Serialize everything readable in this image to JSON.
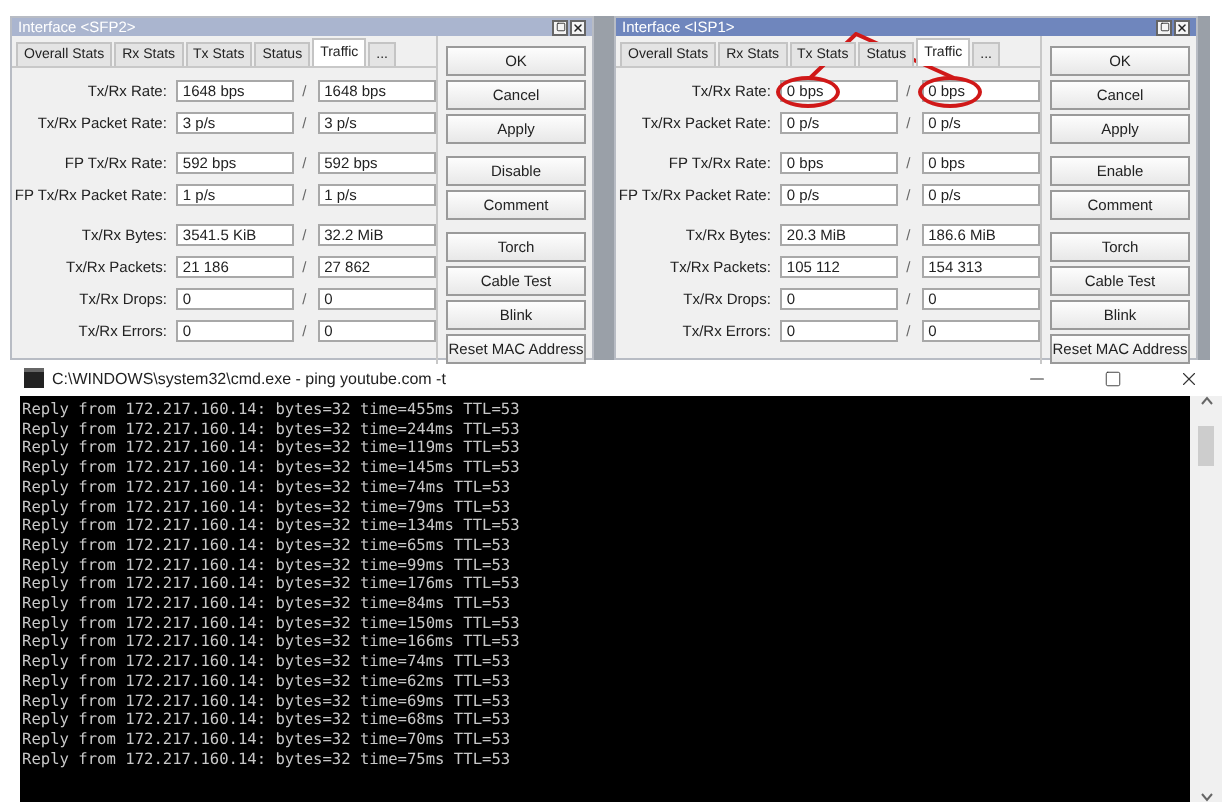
{
  "windows": [
    {
      "title": "Interface <SFP2>",
      "active": false,
      "tabs": [
        {
          "label": "Overall Stats",
          "selected": false
        },
        {
          "label": "Rx Stats",
          "selected": false
        },
        {
          "label": "Tx Stats",
          "selected": false
        },
        {
          "label": "Status",
          "selected": false
        },
        {
          "label": "Traffic",
          "selected": true
        },
        {
          "label": "...",
          "selected": false
        }
      ],
      "sections": [
        [
          {
            "label": "Tx/Rx Rate:",
            "tx": {
              "value": "1648 bps",
              "circled": false
            },
            "separator": "/",
            "rx": {
              "value": "1648 bps",
              "circled": false
            }
          },
          {
            "label": "Tx/Rx Packet Rate:",
            "tx": {
              "value": "3 p/s",
              "circled": false
            },
            "separator": "/",
            "rx": {
              "value": "3 p/s",
              "circled": false
            }
          }
        ],
        [
          {
            "label": "FP Tx/Rx Rate:",
            "tx": {
              "value": "592 bps",
              "circled": false
            },
            "separator": "/",
            "rx": {
              "value": "592 bps",
              "circled": false
            }
          },
          {
            "label": "FP Tx/Rx Packet Rate:",
            "tx": {
              "value": "1 p/s",
              "circled": false
            },
            "separator": "/",
            "rx": {
              "value": "1 p/s",
              "circled": false
            }
          }
        ],
        [
          {
            "label": "Tx/Rx Bytes:",
            "tx": {
              "value": "3541.5 KiB",
              "circled": false
            },
            "separator": "/",
            "rx": {
              "value": "32.2 MiB",
              "circled": false
            }
          },
          {
            "label": "Tx/Rx Packets:",
            "tx": {
              "value": "21 186",
              "circled": false
            },
            "separator": "/",
            "rx": {
              "value": "27 862",
              "circled": false
            }
          },
          {
            "label": "Tx/Rx Drops:",
            "tx": {
              "value": "0",
              "circled": false
            },
            "separator": "/",
            "rx": {
              "value": "0",
              "circled": false
            }
          },
          {
            "label": "Tx/Rx Errors:",
            "tx": {
              "value": "0",
              "circled": false
            },
            "separator": "/",
            "rx": {
              "value": "0",
              "circled": false
            }
          }
        ]
      ],
      "buttons": [
        [
          "OK",
          "Cancel",
          "Apply"
        ],
        [
          "Disable",
          "Comment"
        ],
        [
          "Torch",
          "Cable Test",
          "Blink",
          "Reset MAC Address"
        ]
      ]
    },
    {
      "title": "Interface <ISP1>",
      "active": true,
      "tabs": [
        {
          "label": "Overall Stats",
          "selected": false
        },
        {
          "label": "Rx Stats",
          "selected": false
        },
        {
          "label": "Tx Stats",
          "selected": false
        },
        {
          "label": "Status",
          "selected": false
        },
        {
          "label": "Traffic",
          "selected": true
        },
        {
          "label": "...",
          "selected": false
        }
      ],
      "sections": [
        [
          {
            "label": "Tx/Rx Rate:",
            "tx": {
              "value": "0 bps",
              "circled": true
            },
            "separator": "/",
            "rx": {
              "value": "0 bps",
              "circled": true
            }
          },
          {
            "label": "Tx/Rx Packet Rate:",
            "tx": {
              "value": "0 p/s",
              "circled": false
            },
            "separator": "/",
            "rx": {
              "value": "0 p/s",
              "circled": false
            }
          }
        ],
        [
          {
            "label": "FP Tx/Rx Rate:",
            "tx": {
              "value": "0 bps",
              "circled": false
            },
            "separator": "/",
            "rx": {
              "value": "0 bps",
              "circled": false
            }
          },
          {
            "label": "FP Tx/Rx Packet Rate:",
            "tx": {
              "value": "0 p/s",
              "circled": false
            },
            "separator": "/",
            "rx": {
              "value": "0 p/s",
              "circled": false
            }
          }
        ],
        [
          {
            "label": "Tx/Rx Bytes:",
            "tx": {
              "value": "20.3 MiB",
              "circled": false
            },
            "separator": "/",
            "rx": {
              "value": "186.6 MiB",
              "circled": false
            }
          },
          {
            "label": "Tx/Rx Packets:",
            "tx": {
              "value": "105 112",
              "circled": false
            },
            "separator": "/",
            "rx": {
              "value": "154 313",
              "circled": false
            }
          },
          {
            "label": "Tx/Rx Drops:",
            "tx": {
              "value": "0",
              "circled": false
            },
            "separator": "/",
            "rx": {
              "value": "0",
              "circled": false
            }
          },
          {
            "label": "Tx/Rx Errors:",
            "tx": {
              "value": "0",
              "circled": false
            },
            "separator": "/",
            "rx": {
              "value": "0",
              "circled": false
            }
          }
        ]
      ],
      "buttons": [
        [
          "OK",
          "Cancel",
          "Apply"
        ],
        [
          "Enable",
          "Comment"
        ],
        [
          "Torch",
          "Cable Test",
          "Blink",
          "Reset MAC Address"
        ]
      ]
    }
  ],
  "console": {
    "title": "C:\\WINDOWS\\system32\\cmd.exe - ping  youtube.com -t",
    "lines": [
      "Reply from 172.217.160.14: bytes=32 time=455ms TTL=53",
      "Reply from 172.217.160.14: bytes=32 time=244ms TTL=53",
      "Reply from 172.217.160.14: bytes=32 time=119ms TTL=53",
      "Reply from 172.217.160.14: bytes=32 time=145ms TTL=53",
      "Reply from 172.217.160.14: bytes=32 time=74ms TTL=53",
      "Reply from 172.217.160.14: bytes=32 time=79ms TTL=53",
      "Reply from 172.217.160.14: bytes=32 time=134ms TTL=53",
      "Reply from 172.217.160.14: bytes=32 time=65ms TTL=53",
      "Reply from 172.217.160.14: bytes=32 time=99ms TTL=53",
      "Reply from 172.217.160.14: bytes=32 time=176ms TTL=53",
      "Reply from 172.217.160.14: bytes=32 time=84ms TTL=53",
      "Reply from 172.217.160.14: bytes=32 time=150ms TTL=53",
      "Reply from 172.217.160.14: bytes=32 time=166ms TTL=53",
      "Reply from 172.217.160.14: bytes=32 time=74ms TTL=53",
      "Reply from 172.217.160.14: bytes=32 time=62ms TTL=53",
      "Reply from 172.217.160.14: bytes=32 time=69ms TTL=53",
      "Reply from 172.217.160.14: bytes=32 time=68ms TTL=53",
      "Reply from 172.217.160.14: bytes=32 time=70ms TTL=53",
      "Reply from 172.217.160.14: bytes=32 time=75ms TTL=53"
    ]
  }
}
